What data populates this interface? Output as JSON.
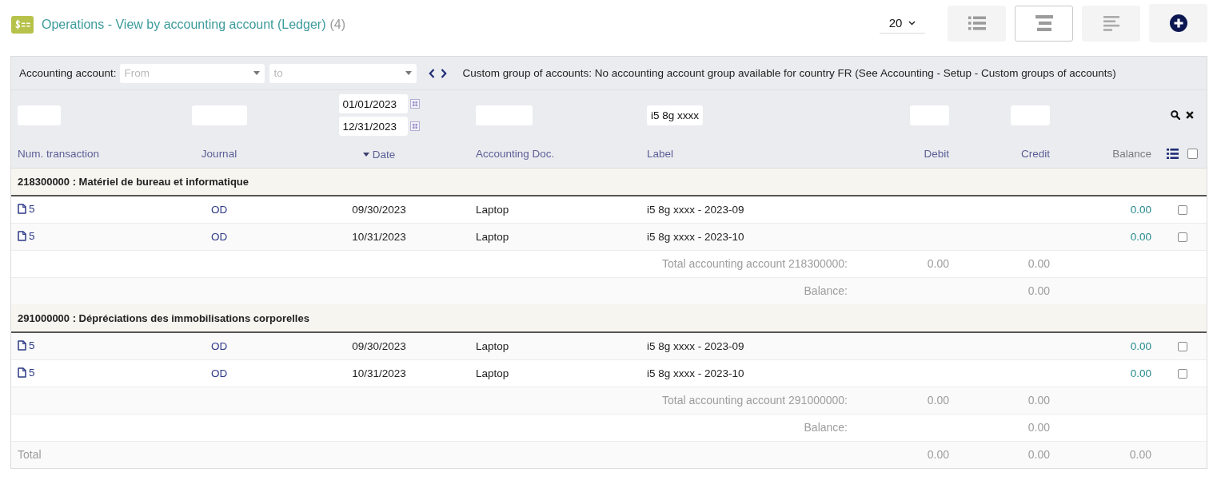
{
  "header": {
    "title": "Operations - View by accounting account (Ledger)",
    "count": "(4)",
    "page_size": "20",
    "view_buttons": [
      {
        "kind": "list",
        "selected": false
      },
      {
        "kind": "bars",
        "selected": true
      },
      {
        "kind": "lines",
        "selected": false
      }
    ]
  },
  "account_filter": {
    "label": "Accounting account:",
    "from": {
      "placeholder": "From"
    },
    "to": {
      "placeholder": "to"
    },
    "note": "Custom group of accounts: No accounting account group available for country FR (See Accounting - Setup - Custom groups of accounts)"
  },
  "table": {
    "columns": [
      {
        "label": "Num. transaction",
        "sortable": true,
        "sorted": false,
        "filter": {
          "kind": "text"
        }
      },
      {
        "label": "Journal",
        "sortable": true,
        "sorted": false,
        "filter": {
          "kind": "text"
        }
      },
      {
        "label": "Date",
        "sortable": true,
        "sorted": true,
        "filter": {
          "kind": "date_range",
          "from": "01/01/2023",
          "to": "12/31/2023"
        }
      },
      {
        "label": "Accounting Doc.",
        "sortable": true,
        "sorted": false,
        "filter": {
          "kind": "text"
        }
      },
      {
        "label": "Label",
        "sortable": true,
        "sorted": false,
        "filter": {
          "kind": "text",
          "value": "i5 8g xxxx"
        }
      },
      {
        "label": "Debit",
        "sortable": true,
        "sorted": false,
        "filter": {
          "kind": "text"
        }
      },
      {
        "label": "Credit",
        "sortable": true,
        "sorted": false,
        "filter": {
          "kind": "text"
        }
      },
      {
        "label": "Balance",
        "sortable": false,
        "sorted": false
      }
    ],
    "select_all": {
      "checked": false
    },
    "groups": [
      {
        "title": "218300000 : Matériel de bureau et informatique",
        "rows": [
          {
            "num_transaction": "5",
            "journal": "OD",
            "date": "09/30/2023",
            "accounting_doc": "Laptop",
            "label": "i5 8g xxxx - 2023-09",
            "balance": "0.00",
            "checked": false
          },
          {
            "num_transaction": "5",
            "journal": "OD",
            "date": "10/31/2023",
            "accounting_doc": "Laptop",
            "label": "i5 8g xxxx - 2023-10",
            "balance": "0.00",
            "checked": false
          }
        ],
        "summary": [
          {
            "label": "Total accounting account 218300000:",
            "debit": "0.00",
            "credit": "0.00"
          },
          {
            "label": "Balance:",
            "credit": "0.00"
          }
        ]
      },
      {
        "title": "291000000 : Dépréciations des immobilisations corporelles",
        "rows": [
          {
            "num_transaction": "5",
            "journal": "OD",
            "date": "09/30/2023",
            "accounting_doc": "Laptop",
            "label": "i5 8g xxxx - 2023-09",
            "balance": "0.00",
            "checked": false
          },
          {
            "num_transaction": "5",
            "journal": "OD",
            "date": "10/31/2023",
            "accounting_doc": "Laptop",
            "label": "i5 8g xxxx - 2023-10",
            "balance": "0.00",
            "checked": false
          }
        ],
        "summary": [
          {
            "label": "Total accounting account 291000000:",
            "debit": "0.00",
            "credit": "0.00"
          },
          {
            "label": "Balance:",
            "credit": "0.00"
          }
        ]
      }
    ],
    "total": {
      "label": "Total",
      "debit": "0.00",
      "credit": "0.00",
      "balance": "0.00"
    }
  }
}
